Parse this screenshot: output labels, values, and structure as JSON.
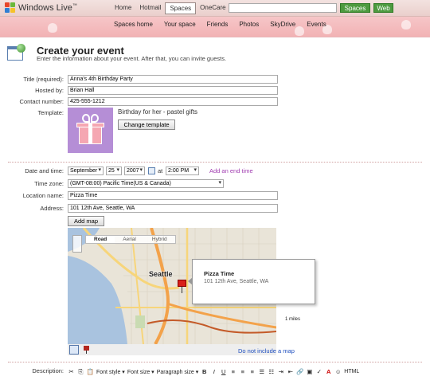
{
  "header": {
    "brand": "Windows Live",
    "brand_mark": "™",
    "nav": [
      "Home",
      "Hotmail",
      "Spaces",
      "OneCare"
    ],
    "active_nav": "Spaces",
    "search_value": "",
    "search_buttons": {
      "spaces": "Spaces",
      "web": "Web"
    }
  },
  "subnav": [
    "Spaces home",
    "Your space",
    "Friends",
    "Photos",
    "SkyDrive",
    "Events"
  ],
  "page": {
    "title": "Create your event",
    "subtitle": "Enter the information about your event. After that, you can invite guests."
  },
  "form": {
    "title_label": "Title (required):",
    "title_value": "Anna's 4th Birthday Party",
    "hosted_label": "Hosted by:",
    "hosted_value": "Brian Hall",
    "contact_label": "Contact number:",
    "contact_value": "425-555-1212",
    "template_label": "Template:",
    "template_name": "Birthday for her - pastel gifts",
    "change_template": "Change template",
    "datetime_label": "Date and time:",
    "month": "September",
    "day": "25",
    "year": "2007",
    "at": "at",
    "time": "2:00 PM",
    "add_end_time": "Add an end time",
    "timezone_label": "Time zone:",
    "timezone": "(GMT-08:00) Pacific Time(US & Canada)",
    "location_label": "Location name:",
    "location_value": "Pizza Time",
    "address_label": "Address:",
    "address_value": "101 12th Ave, Seattle, WA",
    "add_map": "Add map",
    "description_label": "Description:"
  },
  "map": {
    "tabs": [
      "Road",
      "Aerial",
      "Hybrid"
    ],
    "active_tab": "Road",
    "city": "Seattle",
    "callout_title": "Pizza Time",
    "callout_address": "101 12th Ave, Seattle, WA",
    "scale": "1 miles",
    "do_not_include": "Do not include a map",
    "colors": {
      "water": "#a9c3df",
      "land": "#e9e4d8",
      "highway": "#f3a24a",
      "arterial": "#f7d57a"
    }
  },
  "toolbar": {
    "cut": "✂",
    "font_style": "Font style",
    "font_size": "Font size",
    "paragraph_size": "Paragraph size",
    "bold": "B",
    "italic": "I",
    "underline": "U",
    "html": "HTML"
  }
}
